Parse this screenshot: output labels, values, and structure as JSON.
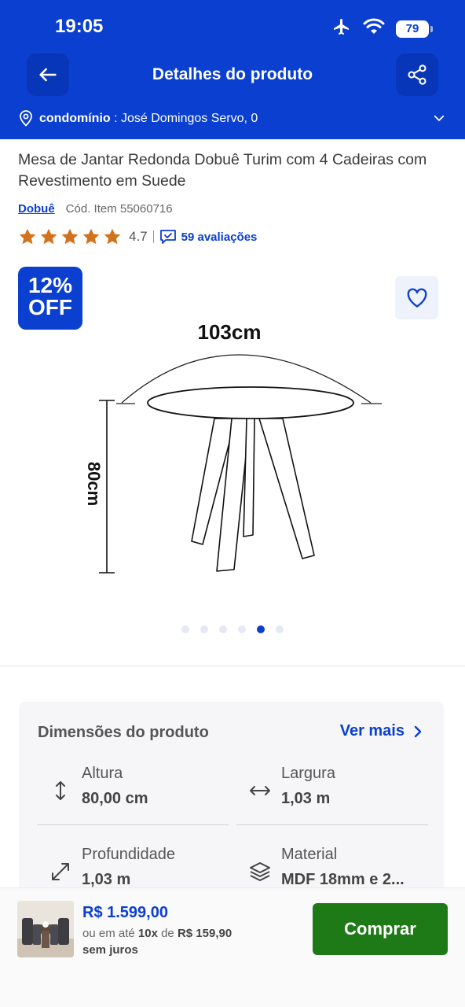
{
  "status_bar": {
    "time": "19:05",
    "battery": "79"
  },
  "header": {
    "title": "Detalhes do produto"
  },
  "location": {
    "label": "condomínio",
    "address": " : José Domingos Servo, 0"
  },
  "product": {
    "title": "Mesa de Jantar Redonda Dobuê Turim com 4 Cadeiras com Revestimento em Suede",
    "brand": "Dobuê",
    "code": "Cód. Item 55060716",
    "rating": "4.7",
    "stars": 5,
    "reviews": "59 avaliações"
  },
  "gallery": {
    "badge_line1": "12%",
    "badge_line2": "OFF",
    "width_label": "103cm",
    "height_label": "80cm",
    "dot_count": 6,
    "active_index": 4
  },
  "dimensions": {
    "title": "Dimensões do produto",
    "see_more": "Ver mais",
    "items": [
      {
        "label": "Altura",
        "value": "80,00 cm",
        "icon": "vertical-arrows-icon"
      },
      {
        "label": "Largura",
        "value": "1,03 m",
        "icon": "horizontal-arrows-icon"
      },
      {
        "label": "Profundidade",
        "value": "1,03 m",
        "icon": "diagonal-arrows-icon"
      },
      {
        "label": "Material",
        "value": "MDF 18mm e 2...",
        "icon": "layers-icon"
      }
    ]
  },
  "purchase": {
    "price": "R$ 1.599,00",
    "installments_prefix": "ou em até ",
    "installments_count": "10x",
    "installments_mid": " de ",
    "installments_value": "R$ 159,90",
    "installments_suffix": "sem juros",
    "buy_label": "Comprar"
  },
  "colors": {
    "primary": "#0a3fd0",
    "buy": "#1e7a17",
    "star": "#d3721c"
  }
}
